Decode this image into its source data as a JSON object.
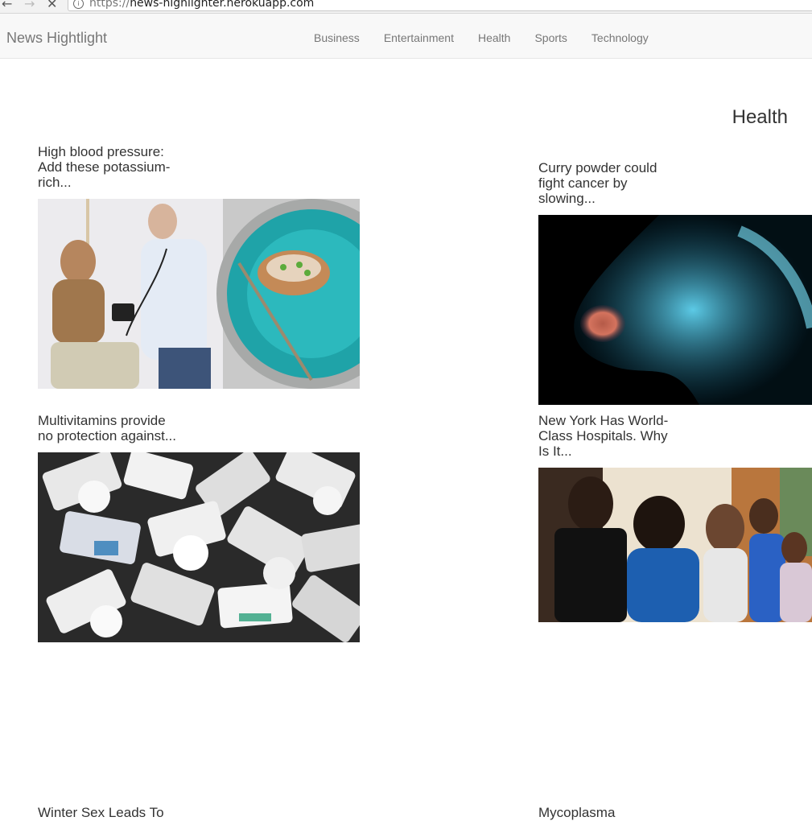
{
  "browser": {
    "url_scheme": "https://",
    "url_host": "news-highlighter.herokuapp.com"
  },
  "navbar": {
    "brand": "News Hightlight",
    "links": [
      "Business",
      "Entertainment",
      "Health",
      "Sports",
      "Technology"
    ]
  },
  "section_title": "Health",
  "articles": [
    {
      "title": "High blood pressure: Add these potassium-rich..."
    },
    {
      "title": "Curry powder could fight cancer by slowing..."
    },
    {
      "title": "Multivitamins provide no protection against..."
    },
    {
      "title": "New York Has World-Class Hospitals. Why Is It..."
    },
    {
      "title": "Winter Sex Leads To"
    },
    {
      "title": "Mycoplasma"
    }
  ],
  "colors": {
    "navbar_bg": "#f8f8f8",
    "nav_text": "#777777",
    "body_text": "#333333"
  }
}
